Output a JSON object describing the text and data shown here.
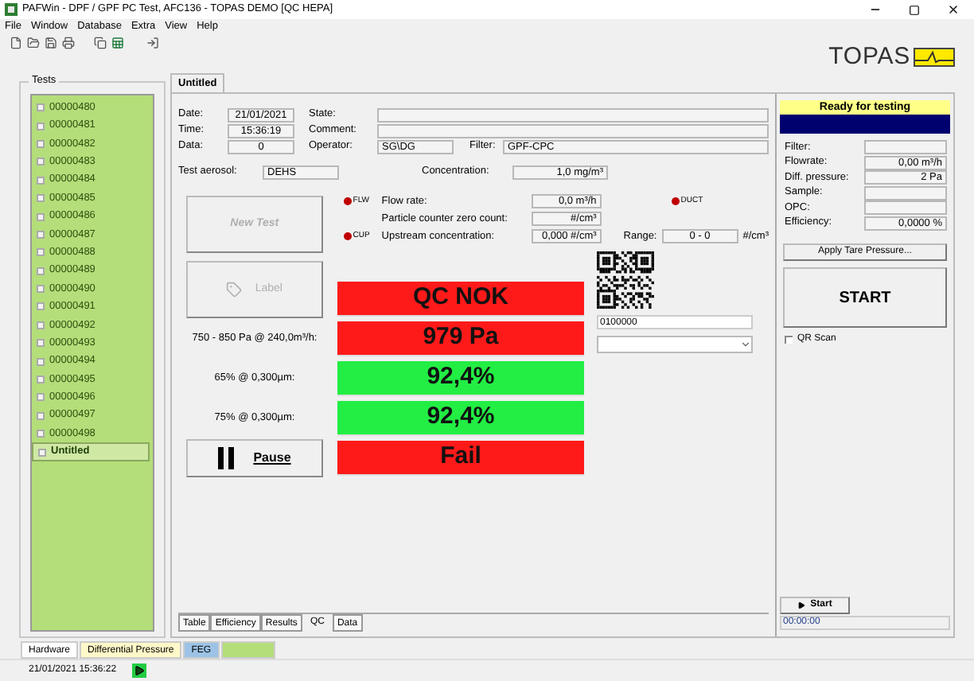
{
  "window": {
    "title": "PAFWin - DPF / GPF PC Test, AFC136 - TOPAS DEMO  [QC HEPA]"
  },
  "menu": [
    "File",
    "Window",
    "Database",
    "Extra",
    "View",
    "Help"
  ],
  "logo": {
    "text": "TOPAS"
  },
  "tests": {
    "title": "Tests",
    "items": [
      {
        "label": "00000480",
        "checked": false,
        "selected": false
      },
      {
        "label": "00000481",
        "checked": false,
        "selected": false
      },
      {
        "label": "00000482",
        "checked": false,
        "selected": false
      },
      {
        "label": "00000483",
        "checked": false,
        "selected": false
      },
      {
        "label": "00000484",
        "checked": false,
        "selected": false
      },
      {
        "label": "00000485",
        "checked": false,
        "selected": false
      },
      {
        "label": "00000486",
        "checked": false,
        "selected": false
      },
      {
        "label": "00000487",
        "checked": false,
        "selected": false
      },
      {
        "label": "00000488",
        "checked": false,
        "selected": false
      },
      {
        "label": "00000489",
        "checked": false,
        "selected": false
      },
      {
        "label": "00000490",
        "checked": false,
        "selected": false
      },
      {
        "label": "00000491",
        "checked": false,
        "selected": false
      },
      {
        "label": "00000492",
        "checked": false,
        "selected": false
      },
      {
        "label": "00000493",
        "checked": false,
        "selected": false
      },
      {
        "label": "00000494",
        "checked": false,
        "selected": false
      },
      {
        "label": "00000495",
        "checked": false,
        "selected": false
      },
      {
        "label": "00000496",
        "checked": false,
        "selected": false
      },
      {
        "label": "00000497",
        "checked": false,
        "selected": false
      },
      {
        "label": "00000498",
        "checked": false,
        "selected": false
      },
      {
        "label": "Untitled",
        "checked": false,
        "selected": true
      }
    ]
  },
  "doc_tab": {
    "label": "Untitled"
  },
  "header": {
    "date": {
      "label": "Date:",
      "value": "21/01/2021"
    },
    "time": {
      "label": "Time:",
      "value": "15:36:19"
    },
    "data": {
      "label": "Data:",
      "value": "0"
    },
    "state": {
      "label": "State:"
    },
    "comment": {
      "label": "Comment:"
    },
    "operator": {
      "label": "Operator:",
      "value": "SG\\DG"
    },
    "filter": {
      "label": "Filter:",
      "value": "GPF-CPC"
    },
    "aerosol": {
      "label": "Test aerosol:",
      "value": "DEHS"
    },
    "concentration": {
      "label": "Concentration:",
      "value": "1,0 mg/m³"
    }
  },
  "actions": {
    "new_test": {
      "label": "New Test",
      "disabled": true
    },
    "label_button": {
      "label": "Label",
      "disabled": true
    },
    "pause": {
      "label": "Pause"
    }
  },
  "measurements": [
    {
      "indicator": "FLW",
      "color": "#c00000",
      "label": "Flow rate:",
      "value": "0,0 m³/h"
    },
    {
      "label": "Particle counter zero count:",
      "value": "#/cm³"
    },
    {
      "indicator": "CUP",
      "color": "#c00000",
      "label": "Upstream concentration:",
      "value": "0,000 #/cm³"
    }
  ],
  "duct": {
    "indicator": "DUCT",
    "color": "#c00000"
  },
  "range": {
    "label": "Range:",
    "value": "0 - 0",
    "unit": "#/cm³"
  },
  "results": [
    {
      "value": "QC NOK",
      "ok": false
    },
    {
      "label": "750 - 850 Pa @  240,0m³/h:",
      "value": "979 Pa",
      "ok": false
    },
    {
      "label": "65% @  0,300µm:",
      "value": "92,4%",
      "ok": true
    },
    {
      "label": "75% @  0,300µm:",
      "value": "92,4%",
      "ok": true
    },
    {
      "value": "Fail",
      "ok": false
    }
  ],
  "qr": {
    "value": "0100000"
  },
  "side": {
    "status": "Ready for testing",
    "readings": [
      {
        "label": "Filter:"
      },
      {
        "label": "Flowrate:",
        "value": "0,00 m³/h"
      },
      {
        "label": "Diff. pressure:",
        "value": "2 Pa"
      },
      {
        "label": "Sample:"
      },
      {
        "label": "OPC:"
      },
      {
        "label": "Efficiency:",
        "value": "0,0000 %"
      }
    ],
    "tare_button": "Apply Tare Pressure...",
    "start_button": "START",
    "qr_scan": {
      "label": "QR Scan",
      "checked": false
    },
    "start_small": "Start",
    "timer": "00:00:00"
  },
  "view_tabs": [
    {
      "label": "Table",
      "selected": false
    },
    {
      "label": "Efficiency",
      "selected": false
    },
    {
      "label": "Results",
      "selected": false
    },
    {
      "label": "QC",
      "selected": true
    },
    {
      "label": "Data",
      "selected": false
    }
  ],
  "status_tabs": [
    {
      "label": "Hardware",
      "color": "#ffffff"
    },
    {
      "label": "Differential Pressure",
      "color": "#fff8c8"
    },
    {
      "label": "FEG",
      "color": "#9cc3e6"
    },
    {
      "color": "#b4de7a"
    }
  ],
  "status_bar": {
    "datetime": "21/01/2021 15:36:22"
  }
}
